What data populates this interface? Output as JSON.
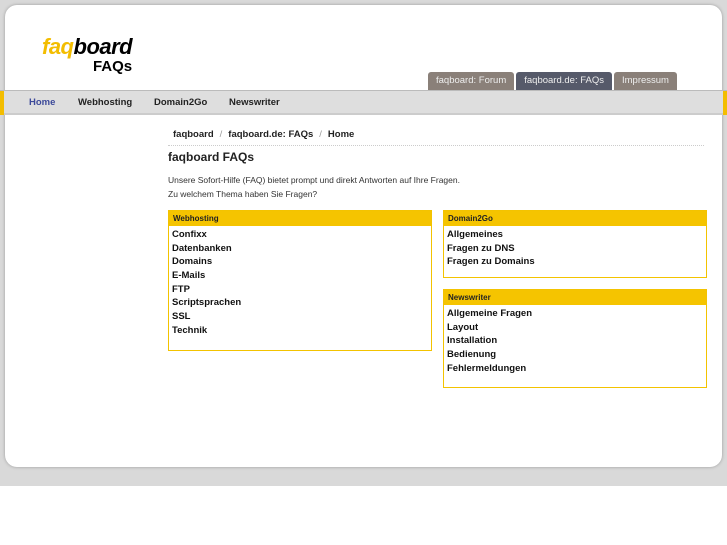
{
  "logo": {
    "part1": "faq",
    "part2": "board",
    "subtitle": "FAQs"
  },
  "tabs": [
    "faqboard: Forum",
    "faqboard.de: FAQs",
    "Impressum"
  ],
  "nav": [
    "Home",
    "Webhosting",
    "Domain2Go",
    "Newswriter"
  ],
  "breadcrumb": [
    "faqboard",
    "faqboard.de: FAQs",
    "Home"
  ],
  "breadcrumb_sep": "/",
  "title": "faqboard FAQs",
  "intro": [
    "Unsere Sofort-Hilfe (FAQ) bietet prompt und direkt Antworten auf Ihre Fragen.",
    "Zu welchem Thema haben Sie Fragen?"
  ],
  "boxes": [
    {
      "title": "Webhosting",
      "items": [
        "Confixx",
        "Datenbanken",
        "Domains",
        "E-Mails",
        "FTP",
        "Scriptsprachen",
        "SSL",
        "Technik"
      ]
    },
    {
      "title": "Domain2Go",
      "items": [
        "Allgemeines",
        "Fragen zu DNS",
        "Fragen zu Domains"
      ]
    },
    {
      "title": "Newswriter",
      "items": [
        "Allgemeine Fragen",
        "Layout",
        "Installation",
        "Bedienung",
        "Fehlermeldungen"
      ]
    }
  ],
  "colors": {
    "accent": "#f5c400",
    "nav_active": "#3d4a9a"
  }
}
